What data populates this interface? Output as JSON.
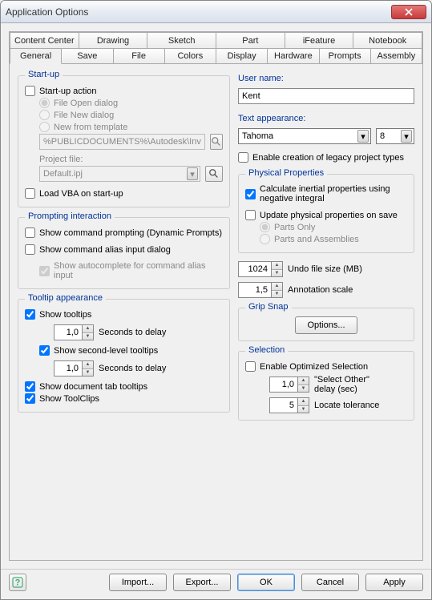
{
  "window": {
    "title": "Application Options"
  },
  "tabs": {
    "row1": [
      "Content Center",
      "Drawing",
      "Sketch",
      "Part",
      "iFeature",
      "Notebook"
    ],
    "row2": [
      "General",
      "Save",
      "File",
      "Colors",
      "Display",
      "Hardware",
      "Prompts",
      "Assembly"
    ],
    "active": "General"
  },
  "startup": {
    "title": "Start-up",
    "startup_action": "Start-up action",
    "file_open": "File Open dialog",
    "file_new": "File New dialog",
    "new_template": "New from template",
    "template_path": "%PUBLICDOCUMENTS%\\Autodesk\\Inv",
    "project_file_label": "Project file:",
    "project_file_value": "Default.ipj",
    "load_vba": "Load VBA on start-up"
  },
  "prompting": {
    "title": "Prompting interaction",
    "show_prompting": "Show command prompting (Dynamic Prompts)",
    "show_alias": "Show command alias input dialog",
    "show_autocomplete": "Show autocomplete for command alias input"
  },
  "tooltip": {
    "title": "Tooltip appearance",
    "show_tooltips": "Show tooltips",
    "seconds1": "1,0",
    "seconds_label": "Seconds to delay",
    "show_second": "Show second-level tooltips",
    "seconds2": "1,0",
    "show_doc_tab": "Show document tab tooltips",
    "show_toolclips": "Show ToolClips"
  },
  "user": {
    "label": "User name:",
    "value": "Kent"
  },
  "text_appearance": {
    "label": "Text appearance:",
    "font": "Tahoma",
    "size": "8"
  },
  "legacy": "Enable creation of legacy project types",
  "physical": {
    "title": "Physical Properties",
    "calc_inertial": "Calculate inertial properties using negative integral",
    "update_on_save": "Update physical properties on save",
    "parts_only": "Parts Only",
    "parts_assemblies": "Parts and Assemblies"
  },
  "undo": {
    "value": "1024",
    "label": "Undo file size (MB)"
  },
  "annotation": {
    "value": "1,5",
    "label": "Annotation scale"
  },
  "grip": {
    "title": "Grip Snap",
    "button": "Options..."
  },
  "selection": {
    "title": "Selection",
    "enable_optimized": "Enable Optimized Selection",
    "select_other_val": "1,0",
    "select_other_label": "\"Select Other\" delay (sec)",
    "locate_val": "5",
    "locate_label": "Locate tolerance"
  },
  "buttons": {
    "import": "Import...",
    "export": "Export...",
    "ok": "OK",
    "cancel": "Cancel",
    "apply": "Apply"
  }
}
